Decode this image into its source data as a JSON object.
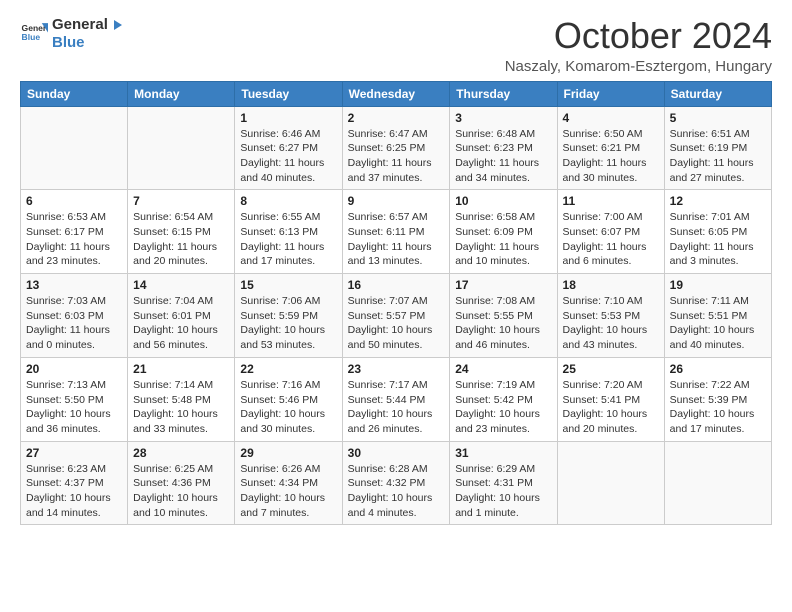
{
  "logo": {
    "line1": "General",
    "line2": "Blue"
  },
  "title": "October 2024",
  "location": "Naszaly, Komarom-Esztergom, Hungary",
  "headers": [
    "Sunday",
    "Monday",
    "Tuesday",
    "Wednesday",
    "Thursday",
    "Friday",
    "Saturday"
  ],
  "weeks": [
    [
      {
        "day": "",
        "sunrise": "",
        "sunset": "",
        "daylight": ""
      },
      {
        "day": "",
        "sunrise": "",
        "sunset": "",
        "daylight": ""
      },
      {
        "day": "1",
        "sunrise": "Sunrise: 6:46 AM",
        "sunset": "Sunset: 6:27 PM",
        "daylight": "Daylight: 11 hours and 40 minutes."
      },
      {
        "day": "2",
        "sunrise": "Sunrise: 6:47 AM",
        "sunset": "Sunset: 6:25 PM",
        "daylight": "Daylight: 11 hours and 37 minutes."
      },
      {
        "day": "3",
        "sunrise": "Sunrise: 6:48 AM",
        "sunset": "Sunset: 6:23 PM",
        "daylight": "Daylight: 11 hours and 34 minutes."
      },
      {
        "day": "4",
        "sunrise": "Sunrise: 6:50 AM",
        "sunset": "Sunset: 6:21 PM",
        "daylight": "Daylight: 11 hours and 30 minutes."
      },
      {
        "day": "5",
        "sunrise": "Sunrise: 6:51 AM",
        "sunset": "Sunset: 6:19 PM",
        "daylight": "Daylight: 11 hours and 27 minutes."
      }
    ],
    [
      {
        "day": "6",
        "sunrise": "Sunrise: 6:53 AM",
        "sunset": "Sunset: 6:17 PM",
        "daylight": "Daylight: 11 hours and 23 minutes."
      },
      {
        "day": "7",
        "sunrise": "Sunrise: 6:54 AM",
        "sunset": "Sunset: 6:15 PM",
        "daylight": "Daylight: 11 hours and 20 minutes."
      },
      {
        "day": "8",
        "sunrise": "Sunrise: 6:55 AM",
        "sunset": "Sunset: 6:13 PM",
        "daylight": "Daylight: 11 hours and 17 minutes."
      },
      {
        "day": "9",
        "sunrise": "Sunrise: 6:57 AM",
        "sunset": "Sunset: 6:11 PM",
        "daylight": "Daylight: 11 hours and 13 minutes."
      },
      {
        "day": "10",
        "sunrise": "Sunrise: 6:58 AM",
        "sunset": "Sunset: 6:09 PM",
        "daylight": "Daylight: 11 hours and 10 minutes."
      },
      {
        "day": "11",
        "sunrise": "Sunrise: 7:00 AM",
        "sunset": "Sunset: 6:07 PM",
        "daylight": "Daylight: 11 hours and 6 minutes."
      },
      {
        "day": "12",
        "sunrise": "Sunrise: 7:01 AM",
        "sunset": "Sunset: 6:05 PM",
        "daylight": "Daylight: 11 hours and 3 minutes."
      }
    ],
    [
      {
        "day": "13",
        "sunrise": "Sunrise: 7:03 AM",
        "sunset": "Sunset: 6:03 PM",
        "daylight": "Daylight: 11 hours and 0 minutes."
      },
      {
        "day": "14",
        "sunrise": "Sunrise: 7:04 AM",
        "sunset": "Sunset: 6:01 PM",
        "daylight": "Daylight: 10 hours and 56 minutes."
      },
      {
        "day": "15",
        "sunrise": "Sunrise: 7:06 AM",
        "sunset": "Sunset: 5:59 PM",
        "daylight": "Daylight: 10 hours and 53 minutes."
      },
      {
        "day": "16",
        "sunrise": "Sunrise: 7:07 AM",
        "sunset": "Sunset: 5:57 PM",
        "daylight": "Daylight: 10 hours and 50 minutes."
      },
      {
        "day": "17",
        "sunrise": "Sunrise: 7:08 AM",
        "sunset": "Sunset: 5:55 PM",
        "daylight": "Daylight: 10 hours and 46 minutes."
      },
      {
        "day": "18",
        "sunrise": "Sunrise: 7:10 AM",
        "sunset": "Sunset: 5:53 PM",
        "daylight": "Daylight: 10 hours and 43 minutes."
      },
      {
        "day": "19",
        "sunrise": "Sunrise: 7:11 AM",
        "sunset": "Sunset: 5:51 PM",
        "daylight": "Daylight: 10 hours and 40 minutes."
      }
    ],
    [
      {
        "day": "20",
        "sunrise": "Sunrise: 7:13 AM",
        "sunset": "Sunset: 5:50 PM",
        "daylight": "Daylight: 10 hours and 36 minutes."
      },
      {
        "day": "21",
        "sunrise": "Sunrise: 7:14 AM",
        "sunset": "Sunset: 5:48 PM",
        "daylight": "Daylight: 10 hours and 33 minutes."
      },
      {
        "day": "22",
        "sunrise": "Sunrise: 7:16 AM",
        "sunset": "Sunset: 5:46 PM",
        "daylight": "Daylight: 10 hours and 30 minutes."
      },
      {
        "day": "23",
        "sunrise": "Sunrise: 7:17 AM",
        "sunset": "Sunset: 5:44 PM",
        "daylight": "Daylight: 10 hours and 26 minutes."
      },
      {
        "day": "24",
        "sunrise": "Sunrise: 7:19 AM",
        "sunset": "Sunset: 5:42 PM",
        "daylight": "Daylight: 10 hours and 23 minutes."
      },
      {
        "day": "25",
        "sunrise": "Sunrise: 7:20 AM",
        "sunset": "Sunset: 5:41 PM",
        "daylight": "Daylight: 10 hours and 20 minutes."
      },
      {
        "day": "26",
        "sunrise": "Sunrise: 7:22 AM",
        "sunset": "Sunset: 5:39 PM",
        "daylight": "Daylight: 10 hours and 17 minutes."
      }
    ],
    [
      {
        "day": "27",
        "sunrise": "Sunrise: 6:23 AM",
        "sunset": "Sunset: 4:37 PM",
        "daylight": "Daylight: 10 hours and 14 minutes."
      },
      {
        "day": "28",
        "sunrise": "Sunrise: 6:25 AM",
        "sunset": "Sunset: 4:36 PM",
        "daylight": "Daylight: 10 hours and 10 minutes."
      },
      {
        "day": "29",
        "sunrise": "Sunrise: 6:26 AM",
        "sunset": "Sunset: 4:34 PM",
        "daylight": "Daylight: 10 hours and 7 minutes."
      },
      {
        "day": "30",
        "sunrise": "Sunrise: 6:28 AM",
        "sunset": "Sunset: 4:32 PM",
        "daylight": "Daylight: 10 hours and 4 minutes."
      },
      {
        "day": "31",
        "sunrise": "Sunrise: 6:29 AM",
        "sunset": "Sunset: 4:31 PM",
        "daylight": "Daylight: 10 hours and 1 minute."
      },
      {
        "day": "",
        "sunrise": "",
        "sunset": "",
        "daylight": ""
      },
      {
        "day": "",
        "sunrise": "",
        "sunset": "",
        "daylight": ""
      }
    ]
  ]
}
